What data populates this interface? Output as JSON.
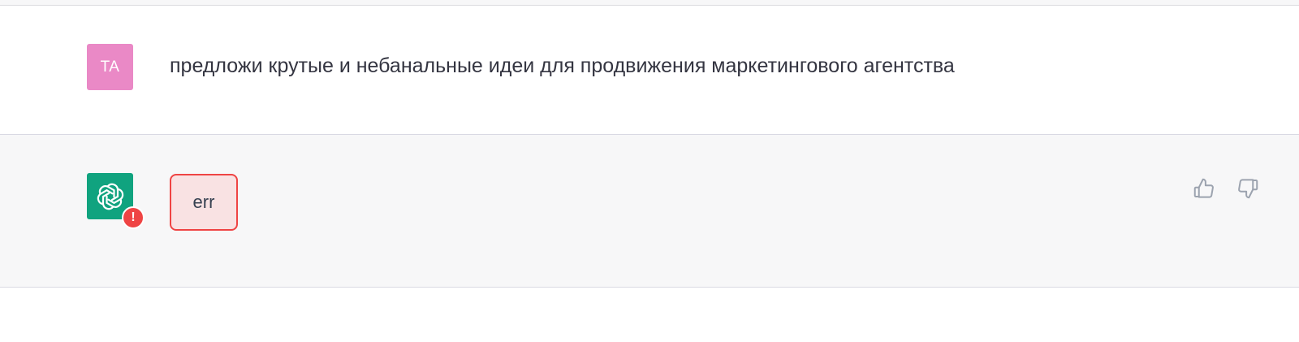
{
  "colors": {
    "user_avatar_bg": "#ea89c6",
    "bot_avatar_bg": "#10a37f",
    "error_red": "#ef4444"
  },
  "conversation": {
    "user_message": {
      "avatar_initials": "TA",
      "text": "предложи крутые и небанальные идеи для продвижения маркетингового агентства"
    },
    "assistant_message": {
      "avatar_icon": "openai-logo-icon",
      "error_badge_icon": "exclamation-icon",
      "error_badge_text": "!",
      "error_text": "err",
      "feedback_icons": [
        "thumbs-up-icon",
        "thumbs-down-icon"
      ]
    }
  }
}
